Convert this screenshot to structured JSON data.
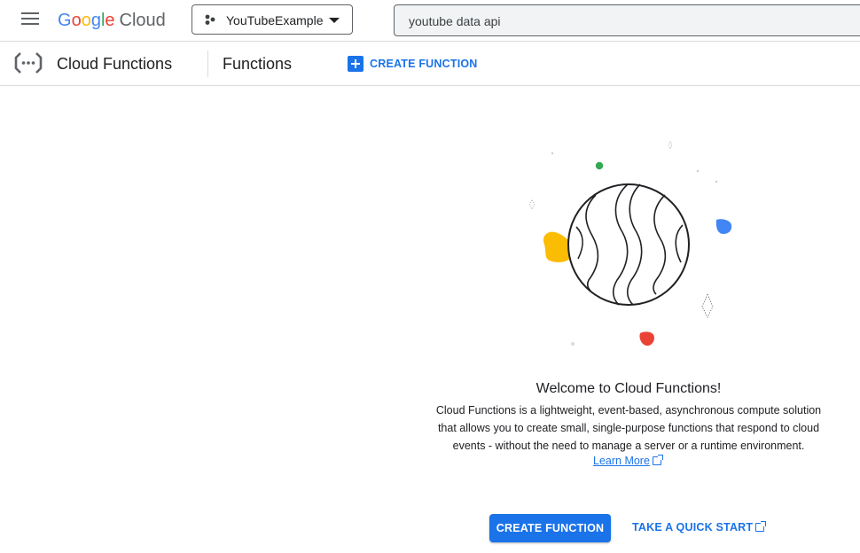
{
  "topbar": {
    "logo_letters": [
      "G",
      "o",
      "o",
      "g",
      "l",
      "e"
    ],
    "logo_cloud": "Cloud",
    "project": "YouTubeExample",
    "search_value": "youtube data api"
  },
  "subheader": {
    "product_title": "Cloud Functions",
    "page_title": "Functions",
    "create_label": "CREATE FUNCTION"
  },
  "welcome": {
    "title": "Welcome to Cloud Functions!",
    "body": "Cloud Functions is a lightweight, event-based, asynchronous compute solution that allows you to create small, single-purpose functions that respond to cloud events - without the need to manage a server or a runtime environment.",
    "learn_more": "Learn More",
    "create_button": "CREATE FUNCTION",
    "quickstart": "TAKE A QUICK START"
  },
  "colors": {
    "accent": "#1a73e8",
    "illustration_green": "#34a853",
    "illustration_yellow": "#fbbc04",
    "illustration_blue": "#4285f4",
    "illustration_red": "#ea4335"
  }
}
